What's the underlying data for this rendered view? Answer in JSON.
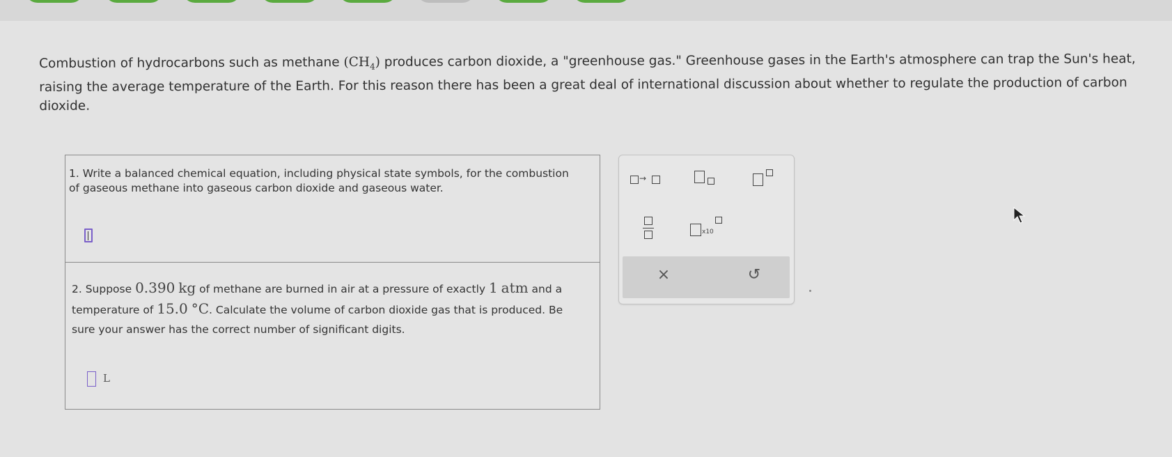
{
  "colors": {
    "background": "#dcdcdc",
    "answer_box_border": "#7a5fc9",
    "top_button": "#5aaa3f"
  },
  "intro": {
    "part1": "Combustion of hydrocarbons such as methane ",
    "formula_open": "(CH",
    "formula_sub": "4",
    "formula_close": ")",
    "part2": " produces carbon dioxide, a \"greenhouse gas.\" Greenhouse gases in the Earth's atmosphere can trap the Sun's heat, raising the average temperature of the Earth. For this reason there has been a great deal of international discussion about whether to regulate the production of carbon dioxide."
  },
  "question1": {
    "text": "1. Write a balanced chemical equation, including physical state symbols, for the combustion of gaseous methane into gaseous carbon dioxide and gaseous water."
  },
  "question2": {
    "t1": "2. Suppose ",
    "mass": "0.390",
    "mass_unit": "kg",
    "t2": " of methane are burned in air at a pressure of exactly ",
    "pressure": "1",
    "pressure_unit": "atm",
    "t3": " and a temperature of ",
    "temperature": "15.0",
    "temperature_unit": "°C",
    "t4": ". Calculate the volume of carbon dioxide gas that is produced. Be sure your answer has the correct number of significant digits.",
    "answer_unit": "L"
  },
  "palette": {
    "arrow_symbol": "→",
    "x10_label": "x10",
    "clear_symbol": "×",
    "undo_symbol": "↺"
  },
  "icons": {
    "reaction_arrow": "reaction-arrow-icon",
    "subscript": "subscript-icon",
    "superscript": "superscript-icon",
    "fraction": "fraction-icon",
    "scientific_notation": "scientific-notation-icon",
    "clear": "clear-icon",
    "undo": "undo-icon"
  }
}
